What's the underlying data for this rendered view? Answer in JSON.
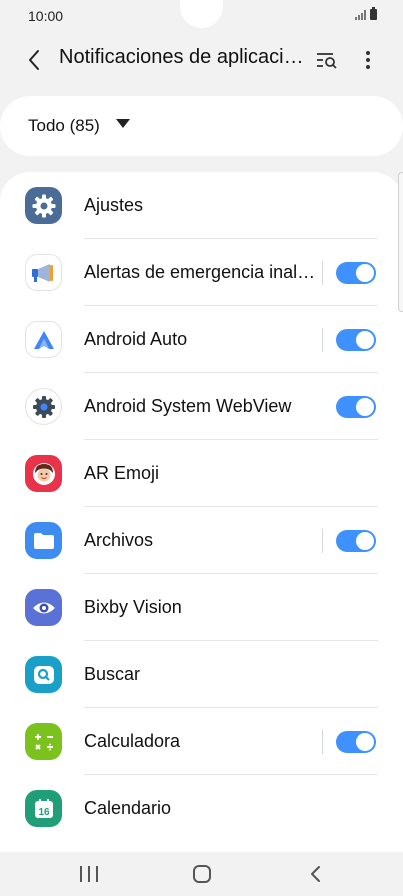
{
  "status_bar": {
    "time": "10:00"
  },
  "header": {
    "title": "Notificaciones de aplicaciones"
  },
  "filter": {
    "label": "Todo (85)"
  },
  "apps": [
    {
      "label": "Ajustes",
      "icon": "settings-gear-icon",
      "toggle": false
    },
    {
      "label": "Alertas de emergencia inalámbricas",
      "icon": "megaphone-icon",
      "toggle": true
    },
    {
      "label": "Android Auto",
      "icon": "android-auto-icon",
      "toggle": true
    },
    {
      "label": "Android System WebView",
      "icon": "webview-gear-icon",
      "toggle": true
    },
    {
      "label": "AR Emoji",
      "icon": "ar-emoji-icon",
      "toggle": false
    },
    {
      "label": "Archivos",
      "icon": "folder-icon",
      "toggle": true
    },
    {
      "label": "Bixby Vision",
      "icon": "eye-icon",
      "toggle": false
    },
    {
      "label": "Buscar",
      "icon": "search-app-icon",
      "toggle": false
    },
    {
      "label": "Calculadora",
      "icon": "calculator-icon",
      "toggle": true
    },
    {
      "label": "Calendario",
      "icon": "calendar-icon",
      "toggle": false,
      "calendar_day": "16"
    }
  ],
  "colors": {
    "accent": "#3e91ff",
    "background": "#f2f2f2",
    "card": "#ffffff"
  }
}
